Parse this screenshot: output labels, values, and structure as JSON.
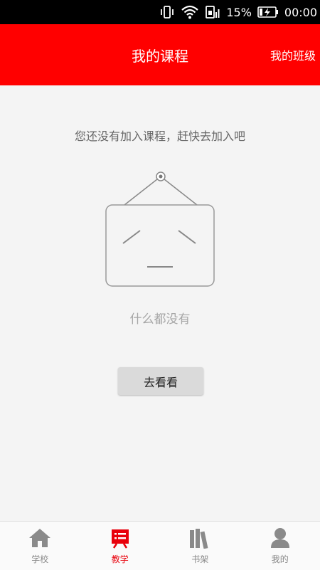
{
  "status_bar": {
    "battery_percent": "15%",
    "time": "00:00"
  },
  "header": {
    "title": "我的课程",
    "right_link": "我的班级",
    "color": "#ff0000"
  },
  "main": {
    "empty_message": "您还没有加入课程，赶快去加入吧",
    "nothing_text": "什么都没有",
    "go_button_label": "去看看"
  },
  "tabbar": {
    "active_color": "#e8000b",
    "items": [
      {
        "label": "学校",
        "icon": "home-icon"
      },
      {
        "label": "教学",
        "icon": "teaching-icon"
      },
      {
        "label": "书架",
        "icon": "bookshelf-icon"
      },
      {
        "label": "我的",
        "icon": "profile-icon"
      }
    ]
  }
}
